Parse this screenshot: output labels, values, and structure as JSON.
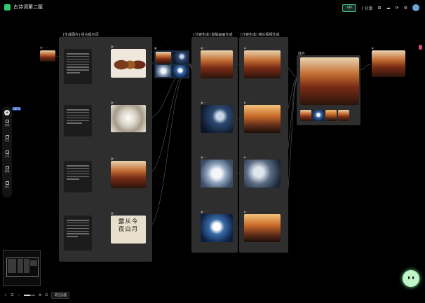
{
  "app": {
    "title": "古诗词第二版"
  },
  "toolbar": {
    "badge": "VIP",
    "items": [
      "⟨ 分享",
      "⊞",
      "☁",
      "⟳",
      "⚙"
    ]
  },
  "groups": {
    "left": "[生成图片] 组合提示词",
    "mid1": "[分镜生成] 基础画面生成",
    "mid2": "[分镜生成] 镜头视频生成",
    "output": "成片"
  },
  "sidebar": {
    "new_tag": "NEW",
    "items": [
      "剪辑",
      "节点",
      "生成",
      "管理",
      "组件"
    ]
  },
  "bottom": {
    "zoom_button": "适应画面"
  },
  "colors": {
    "accent": "#2ecc71",
    "panel": "#2e2e2e",
    "fab": "#bff5c8"
  }
}
